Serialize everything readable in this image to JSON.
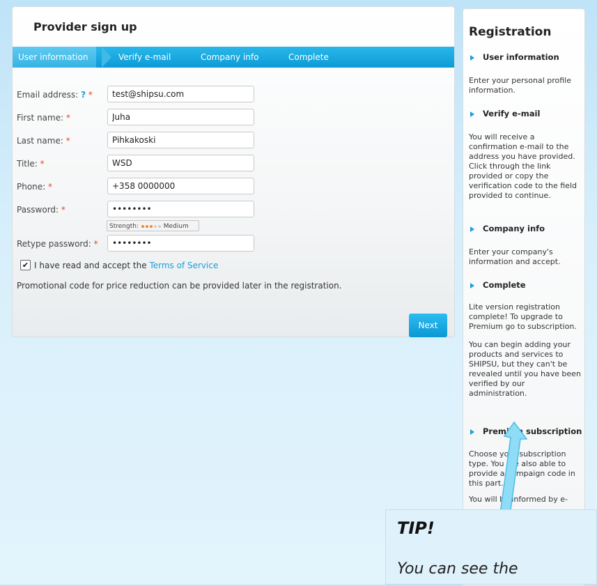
{
  "form": {
    "title": "Provider sign up",
    "steps": [
      "User information",
      "Verify e-mail",
      "Company info",
      "Complete"
    ],
    "fields": {
      "email": {
        "label": "Email address:",
        "help": "?",
        "required": "*",
        "value": "test@shipsu.com"
      },
      "first_name": {
        "label": "First name:",
        "required": "*",
        "value": "Juha"
      },
      "last_name": {
        "label": "Last name:",
        "required": "*",
        "value": "Pihkakoski"
      },
      "title": {
        "label": "Title:",
        "required": "*",
        "value": "WSD"
      },
      "phone": {
        "label": "Phone:",
        "required": "*",
        "value": "+358 0000000"
      },
      "password": {
        "label": "Password:",
        "required": "*",
        "value": "••••••••"
      },
      "retype_password": {
        "label": "Retype password:",
        "required": "*",
        "value": "••••••••"
      }
    },
    "strength": {
      "label": "Strength:",
      "level_text": "Medium",
      "filled_dots": 3,
      "total_dots": 5
    },
    "terms": {
      "checked": true,
      "text": "I have read and accept the",
      "link": "Terms of Service"
    },
    "promo_text": "Promotional code for price reduction can be provided later in the registration.",
    "next_label": "Next"
  },
  "sidebar": {
    "title": "Registration",
    "sections": [
      {
        "heading": "User information",
        "text": "Enter your personal profile information."
      },
      {
        "heading": "Verify e-mail",
        "text": "You will receive a confirmation e-mail to the address you have provided. Click through the link provided or copy the verification code to the field provided to continue."
      },
      {
        "heading": "Company info",
        "text": "Enter your company's information and accept."
      },
      {
        "heading": "Complete",
        "text": "Lite version registration complete! To upgrade to Premium go to subscription.",
        "text2": "You can begin adding your products and services to SHIPSU, but they can't be revealed until you have been verified by our administration."
      },
      {
        "heading": "Premium subscription",
        "text": "Choose your subscription type. You are also able to provide a campaign code in this part.",
        "text2": "You will be informed by e-"
      }
    ]
  },
  "tip": {
    "title": "TIP!",
    "text": "You can see the"
  },
  "colors": {
    "accent": "#0c9bd6",
    "required": "#e2472b",
    "link": "#1a9fd8"
  }
}
